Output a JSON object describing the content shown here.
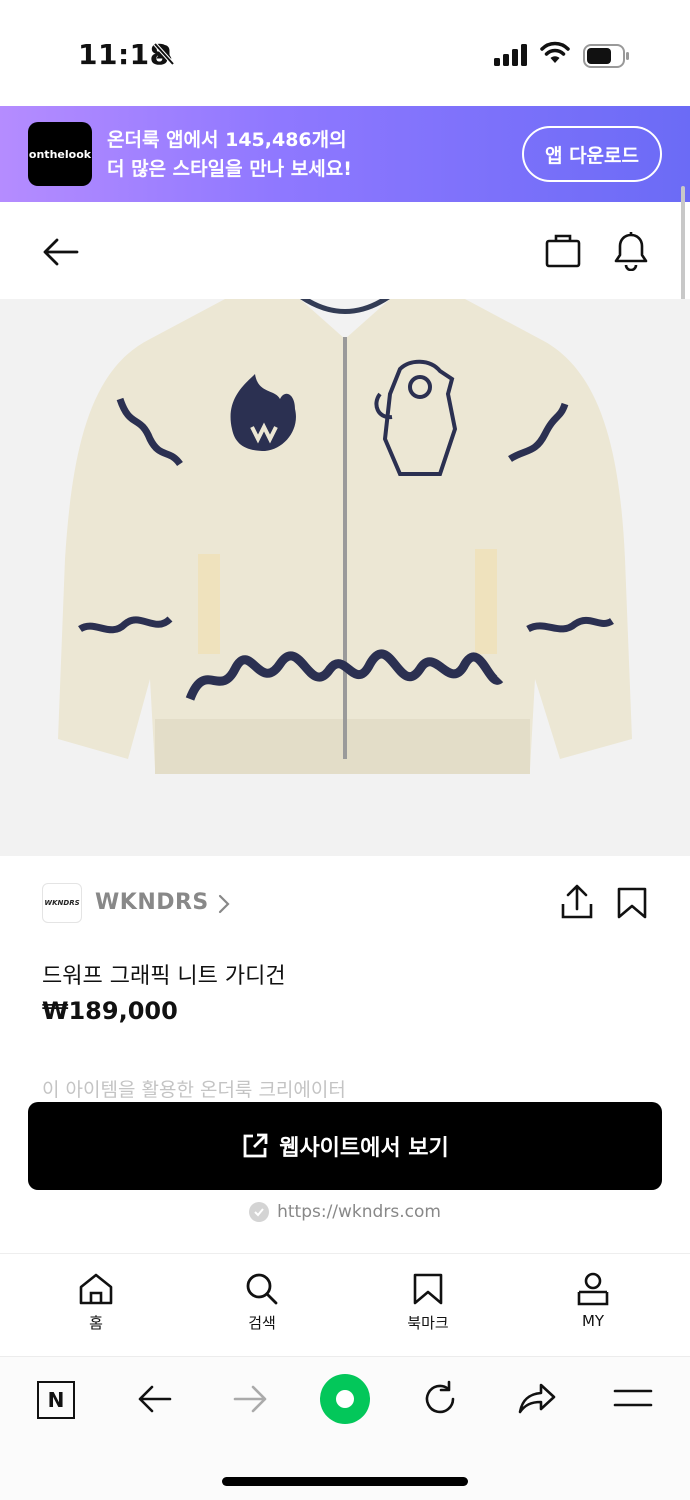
{
  "status_bar": {
    "time": "11:18"
  },
  "promo": {
    "logo_text": "onthelook",
    "line1": "온더룩 앱에서 145,486개의",
    "line2": "더 많은 스타일을 만나 보세요!",
    "button_label": "앱 다운로드"
  },
  "brand": {
    "logo_text": "WKNDRS",
    "name": "WKNDRS"
  },
  "product": {
    "name": "드워프 그래픽 니트 가디건",
    "price": "₩189,000"
  },
  "creator_label": "이 아이템을 활용한 온더룩 크리에이터",
  "cta": {
    "label": "웹사이트에서 보기",
    "url": "https://wkndrs.com"
  },
  "tabs": [
    {
      "label": "홈",
      "icon": "home-icon"
    },
    {
      "label": "검색",
      "icon": "search-icon"
    },
    {
      "label": "북마크",
      "icon": "bookmark-icon"
    },
    {
      "label": "MY",
      "icon": "user-icon"
    }
  ],
  "browser_toolbar": {
    "home_label": "N"
  },
  "colors": {
    "promo_start": "#b58cff",
    "promo_end": "#6b6bf6",
    "cta_bg": "#000000",
    "browser_green": "#03c75a"
  }
}
